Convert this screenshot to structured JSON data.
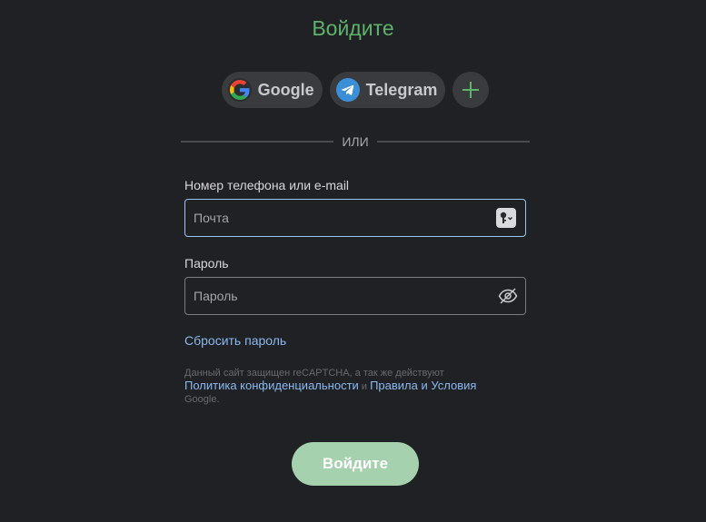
{
  "header": {
    "title": "Войдите"
  },
  "social": {
    "google_label": "Google",
    "telegram_label": "Telegram",
    "add_symbol": "+"
  },
  "divider": {
    "text": "ИЛИ"
  },
  "form": {
    "login_label": "Номер телефона или e-mail",
    "login_placeholder": "Почта",
    "login_value": "",
    "password_label": "Пароль",
    "password_placeholder": "Пароль",
    "password_value": "",
    "reset_link": "Сбросить пароль"
  },
  "recaptcha": {
    "text_before": "Данный сайт защищен reCAPTCHA, а так же действуют",
    "privacy_link": "Политика конфиденциальности",
    "conjunction": "и",
    "terms_link": "Правила и Условия",
    "text_after": "Google."
  },
  "submit": {
    "label": "Войдите"
  },
  "colors": {
    "background": "#202124",
    "title": "#5db36a",
    "link": "#8ab8f0",
    "submit_bg": "#a6d1ae",
    "focus_border": "#9cc6f0",
    "telegram": "#3b8fd6"
  }
}
